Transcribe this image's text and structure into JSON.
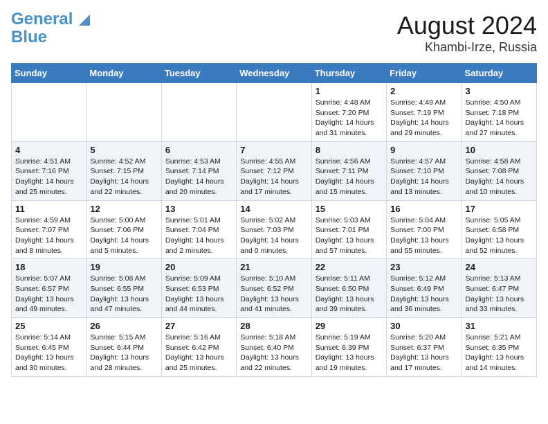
{
  "header": {
    "logo_line1": "General",
    "logo_line2": "Blue",
    "title": "August 2024",
    "subtitle": "Khambi-Irze, Russia"
  },
  "weekdays": [
    "Sunday",
    "Monday",
    "Tuesday",
    "Wednesday",
    "Thursday",
    "Friday",
    "Saturday"
  ],
  "weeks": [
    [
      {
        "day": "",
        "text": ""
      },
      {
        "day": "",
        "text": ""
      },
      {
        "day": "",
        "text": ""
      },
      {
        "day": "",
        "text": ""
      },
      {
        "day": "1",
        "text": "Sunrise: 4:48 AM\nSunset: 7:20 PM\nDaylight: 14 hours and 31 minutes."
      },
      {
        "day": "2",
        "text": "Sunrise: 4:49 AM\nSunset: 7:19 PM\nDaylight: 14 hours and 29 minutes."
      },
      {
        "day": "3",
        "text": "Sunrise: 4:50 AM\nSunset: 7:18 PM\nDaylight: 14 hours and 27 minutes."
      }
    ],
    [
      {
        "day": "4",
        "text": "Sunrise: 4:51 AM\nSunset: 7:16 PM\nDaylight: 14 hours and 25 minutes."
      },
      {
        "day": "5",
        "text": "Sunrise: 4:52 AM\nSunset: 7:15 PM\nDaylight: 14 hours and 22 minutes."
      },
      {
        "day": "6",
        "text": "Sunrise: 4:53 AM\nSunset: 7:14 PM\nDaylight: 14 hours and 20 minutes."
      },
      {
        "day": "7",
        "text": "Sunrise: 4:55 AM\nSunset: 7:12 PM\nDaylight: 14 hours and 17 minutes."
      },
      {
        "day": "8",
        "text": "Sunrise: 4:56 AM\nSunset: 7:11 PM\nDaylight: 14 hours and 15 minutes."
      },
      {
        "day": "9",
        "text": "Sunrise: 4:57 AM\nSunset: 7:10 PM\nDaylight: 14 hours and 13 minutes."
      },
      {
        "day": "10",
        "text": "Sunrise: 4:58 AM\nSunset: 7:08 PM\nDaylight: 14 hours and 10 minutes."
      }
    ],
    [
      {
        "day": "11",
        "text": "Sunrise: 4:59 AM\nSunset: 7:07 PM\nDaylight: 14 hours and 8 minutes."
      },
      {
        "day": "12",
        "text": "Sunrise: 5:00 AM\nSunset: 7:06 PM\nDaylight: 14 hours and 5 minutes."
      },
      {
        "day": "13",
        "text": "Sunrise: 5:01 AM\nSunset: 7:04 PM\nDaylight: 14 hours and 2 minutes."
      },
      {
        "day": "14",
        "text": "Sunrise: 5:02 AM\nSunset: 7:03 PM\nDaylight: 14 hours and 0 minutes."
      },
      {
        "day": "15",
        "text": "Sunrise: 5:03 AM\nSunset: 7:01 PM\nDaylight: 13 hours and 57 minutes."
      },
      {
        "day": "16",
        "text": "Sunrise: 5:04 AM\nSunset: 7:00 PM\nDaylight: 13 hours and 55 minutes."
      },
      {
        "day": "17",
        "text": "Sunrise: 5:05 AM\nSunset: 6:58 PM\nDaylight: 13 hours and 52 minutes."
      }
    ],
    [
      {
        "day": "18",
        "text": "Sunrise: 5:07 AM\nSunset: 6:57 PM\nDaylight: 13 hours and 49 minutes."
      },
      {
        "day": "19",
        "text": "Sunrise: 5:08 AM\nSunset: 6:55 PM\nDaylight: 13 hours and 47 minutes."
      },
      {
        "day": "20",
        "text": "Sunrise: 5:09 AM\nSunset: 6:53 PM\nDaylight: 13 hours and 44 minutes."
      },
      {
        "day": "21",
        "text": "Sunrise: 5:10 AM\nSunset: 6:52 PM\nDaylight: 13 hours and 41 minutes."
      },
      {
        "day": "22",
        "text": "Sunrise: 5:11 AM\nSunset: 6:50 PM\nDaylight: 13 hours and 39 minutes."
      },
      {
        "day": "23",
        "text": "Sunrise: 5:12 AM\nSunset: 6:49 PM\nDaylight: 13 hours and 36 minutes."
      },
      {
        "day": "24",
        "text": "Sunrise: 5:13 AM\nSunset: 6:47 PM\nDaylight: 13 hours and 33 minutes."
      }
    ],
    [
      {
        "day": "25",
        "text": "Sunrise: 5:14 AM\nSunset: 6:45 PM\nDaylight: 13 hours and 30 minutes."
      },
      {
        "day": "26",
        "text": "Sunrise: 5:15 AM\nSunset: 6:44 PM\nDaylight: 13 hours and 28 minutes."
      },
      {
        "day": "27",
        "text": "Sunrise: 5:16 AM\nSunset: 6:42 PM\nDaylight: 13 hours and 25 minutes."
      },
      {
        "day": "28",
        "text": "Sunrise: 5:18 AM\nSunset: 6:40 PM\nDaylight: 13 hours and 22 minutes."
      },
      {
        "day": "29",
        "text": "Sunrise: 5:19 AM\nSunset: 6:39 PM\nDaylight: 13 hours and 19 minutes."
      },
      {
        "day": "30",
        "text": "Sunrise: 5:20 AM\nSunset: 6:37 PM\nDaylight: 13 hours and 17 minutes."
      },
      {
        "day": "31",
        "text": "Sunrise: 5:21 AM\nSunset: 6:35 PM\nDaylight: 13 hours and 14 minutes."
      }
    ]
  ]
}
